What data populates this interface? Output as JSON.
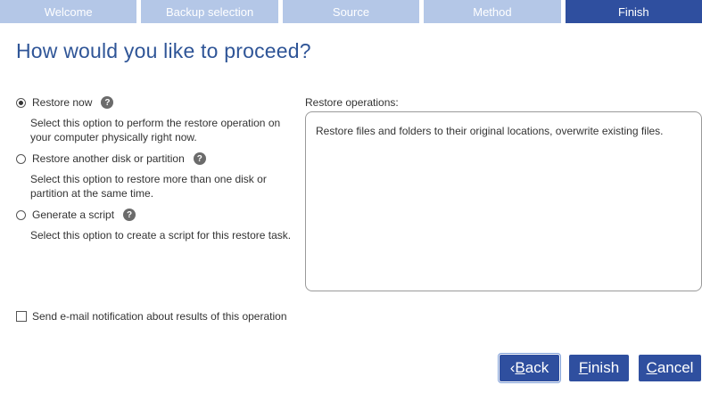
{
  "wizard": {
    "steps": [
      {
        "label": "Welcome",
        "active": false
      },
      {
        "label": "Backup selection",
        "active": false
      },
      {
        "label": "Source",
        "active": false
      },
      {
        "label": "Method",
        "active": false
      },
      {
        "label": "Finish",
        "active": true
      }
    ]
  },
  "page": {
    "title": "How would you like to proceed?"
  },
  "options": [
    {
      "label": "Restore now",
      "checked": true,
      "description": "Select this option to perform the restore operation on your computer physically right now."
    },
    {
      "label": "Restore another disk or partition",
      "checked": false,
      "description": "Select this option to restore more than one disk or partition at the same time."
    },
    {
      "label": "Generate a script",
      "checked": false,
      "description": "Select this option to create a script for this restore task."
    }
  ],
  "help_glyph": "?",
  "restore_operations": {
    "label": "Restore operations:",
    "text": "Restore files and folders to their original locations, overwrite existing files."
  },
  "email_notification": {
    "label": "Send e-mail notification about results of this operation",
    "checked": false
  },
  "buttons": {
    "back": {
      "prefix": "‹ ",
      "accel": "B",
      "rest": "ack"
    },
    "finish": {
      "accel": "F",
      "rest": "inish"
    },
    "cancel": {
      "accel": "C",
      "rest": "ancel"
    }
  },
  "colors": {
    "step_inactive": "#b4c7e7",
    "step_active": "#2f4f9f",
    "title": "#2f5597",
    "button": "#2f4f9f"
  },
  "icons": {
    "help": "question-mark-circle-icon",
    "radio": "radio-button-icon",
    "checkbox": "checkbox-icon"
  }
}
